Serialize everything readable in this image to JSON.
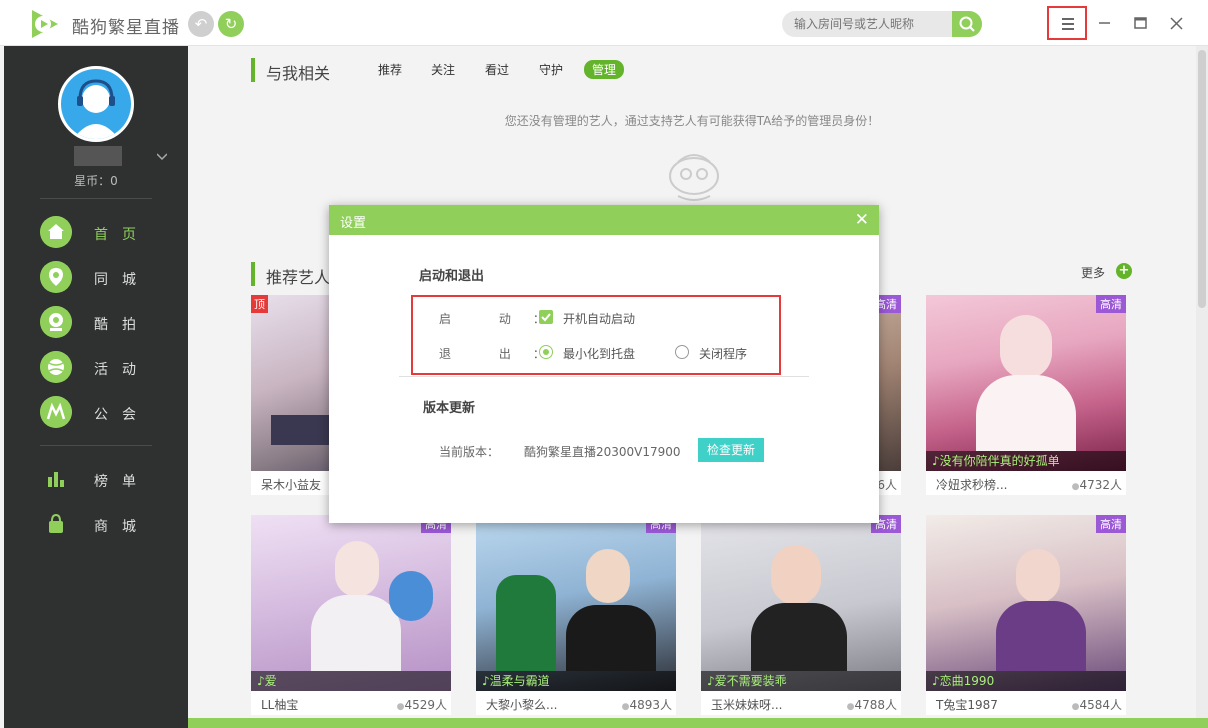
{
  "app": {
    "title": "酷狗繁星直播"
  },
  "search": {
    "placeholder": "输入房间号或艺人昵称"
  },
  "sidebar": {
    "stars": "星币：0",
    "items": [
      {
        "label": "首页",
        "icon": "home-icon",
        "active": true
      },
      {
        "label": "同城",
        "icon": "location-pin-icon"
      },
      {
        "label": "酷拍",
        "icon": "camera-icon"
      },
      {
        "label": "活动",
        "icon": "ball-icon"
      },
      {
        "label": "公会",
        "icon": "guild-icon"
      },
      {
        "label": "榜单",
        "icon": "bar-chart-icon"
      },
      {
        "label": "商城",
        "icon": "shopping-bag-icon"
      }
    ]
  },
  "section1": {
    "title": "与我相关",
    "tabs": [
      "推荐",
      "关注",
      "看过",
      "守护",
      "管理"
    ],
    "active_tab": "管理",
    "empty_message": "您还没有管理的艺人，通过支持艺人有可能获得TA给予的管理员身份！"
  },
  "section2": {
    "title": "推荐艺人",
    "more": "更多"
  },
  "cards_row1": [
    {
      "name": "呆木小益友",
      "viewers": "",
      "song": "",
      "badge": "顶"
    },
    {
      "name": "",
      "viewers": "6人",
      "song": "",
      "badge": "高清"
    },
    {
      "name": "冷妞求秒榜...",
      "viewers": "4732人",
      "song": "♪没有你陪伴真的好孤单",
      "badge": "高清"
    }
  ],
  "cards_row2": [
    {
      "name": "LL柚宝",
      "viewers": "4529人",
      "song": "♪爱",
      "badge": "高清"
    },
    {
      "name": "大黎小黎么...",
      "viewers": "4893人",
      "song": "♪温柔与霸道",
      "badge": "高清"
    },
    {
      "name": "玉米妹妹呀...",
      "viewers": "4788人",
      "song": "♪爱不需要装乖",
      "badge": "高清"
    },
    {
      "name": "T兔宝1987",
      "viewers": "4584人",
      "song": "♪恋曲1990",
      "badge": "高清"
    }
  ],
  "settings_dialog": {
    "title": "设置",
    "startup_section": "启动和退出",
    "start_label": "启 动：",
    "autostart": "开机自动启动",
    "exit_label": "退 出：",
    "option_minimize": "最小化到托盘",
    "option_close": "关闭程序",
    "update_section": "版本更新",
    "version_label": "当前版本：",
    "version_value": "酷狗繁星直播20300V17900",
    "check_update": "检查更新"
  }
}
